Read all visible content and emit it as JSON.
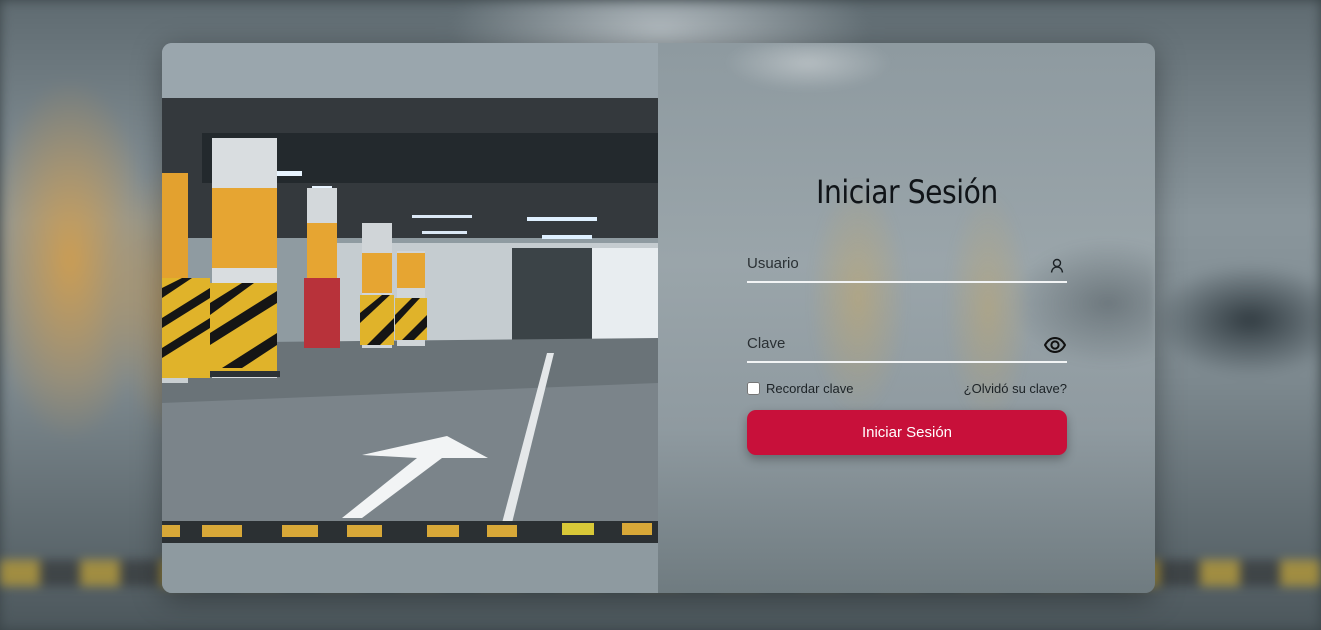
{
  "login": {
    "title": "Iniciar Sesión",
    "username_placeholder": "Usuario",
    "username_value": "",
    "username_icon": "user-icon",
    "password_placeholder": "Clave",
    "password_value": "",
    "password_icon": "eye-icon",
    "remember_label": "Recordar clave",
    "remember_checked": false,
    "forgot_link": "¿Olvidó su clave?",
    "submit_label": "Iniciar Sesión"
  },
  "colors": {
    "accent": "#c8103a",
    "underline": "#f2f4f5",
    "title": "#101418"
  }
}
